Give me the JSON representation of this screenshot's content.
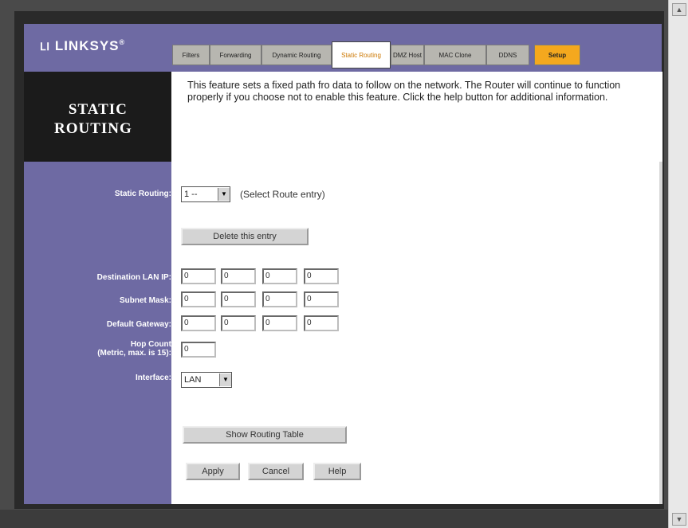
{
  "header": {
    "brand": "Linksys",
    "logo_text": "LINKSYS",
    "tabs": [
      {
        "label": "Filters",
        "active": false
      },
      {
        "label": "Forwarding",
        "active": false
      },
      {
        "label": "Dynamic Routing",
        "active": false
      },
      {
        "label": "Static Routing",
        "active": true
      },
      {
        "label": "DMZ Host",
        "active": false
      },
      {
        "label": "MAC Clone",
        "active": false
      },
      {
        "label": "DDNS",
        "active": false
      },
      {
        "label": "Setup",
        "active": false
      }
    ]
  },
  "page": {
    "title_line1": "STATIC",
    "title_line2": "ROUTING",
    "description": "This feature sets a fixed path fro data to follow on the network. The Router will continue to function properly if you choose not to enable this feature. Click the help button for additional information."
  },
  "form": {
    "static_routing_label": "Static Routing:",
    "route_entry_value": "1 --",
    "route_entry_hint": "(Select Route entry)",
    "delete_button": "Delete this entry",
    "dest_lan_ip_label": "Destination LAN IP:",
    "dest_lan_ip": [
      "0",
      "0",
      "0",
      "0"
    ],
    "subnet_mask_label": "Subnet Mask:",
    "subnet_mask": [
      "0",
      "0",
      "0",
      "0"
    ],
    "default_gateway_label": "Default Gateway:",
    "default_gateway": [
      "0",
      "0",
      "0",
      "0"
    ],
    "hop_count_label": "Hop Count",
    "hop_count_sublabel": "(Metric, max. is 15):",
    "hop_count": "0",
    "interface_label": "Interface:",
    "interface_value": "LAN",
    "show_table_button": "Show Routing Table",
    "apply_button": "Apply",
    "cancel_button": "Cancel",
    "help_button": "Help"
  },
  "colors": {
    "header_purple": "#6e6aa3",
    "active_tab_text": "#cc7700",
    "setup_tab": "#f4a81e"
  }
}
